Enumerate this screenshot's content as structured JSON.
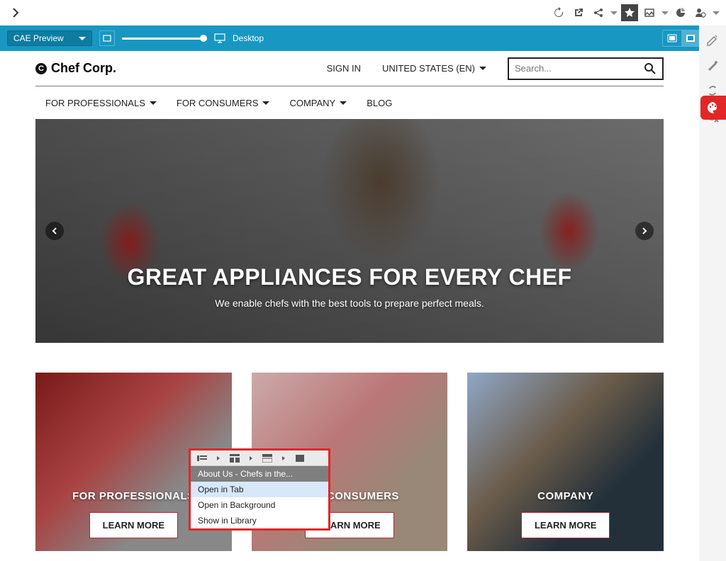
{
  "preview": {
    "selector_label": "CAE Preview",
    "viewport_label": "Desktop"
  },
  "site": {
    "brand": "Chef Corp.",
    "sign_in": "SIGN IN",
    "locale": "UNITED STATES (EN)",
    "search_placeholder": "Search...",
    "nav": {
      "professionals": "FOR PROFESSIONALS",
      "consumers": "FOR CONSUMERS",
      "company": "COMPANY",
      "blog": "BLOG"
    },
    "hero": {
      "title": "GREAT APPLIANCES FOR EVERY CHEF",
      "subtitle": "We enable chefs with the best tools to prepare perfect meals."
    },
    "cards": {
      "professionals": {
        "title": "FOR PROFESSIONALS",
        "cta": "LEARN MORE"
      },
      "consumers": {
        "title": "FOR CONSUMERS",
        "cta": "LEARN MORE"
      },
      "company": {
        "title": "COMPANY",
        "cta": "LEARN MORE"
      }
    }
  },
  "context_menu": {
    "title": "About Us - Chefs in the...",
    "open_tab": "Open in Tab",
    "open_bg": "Open in Background",
    "show_lib": "Show in Library"
  }
}
